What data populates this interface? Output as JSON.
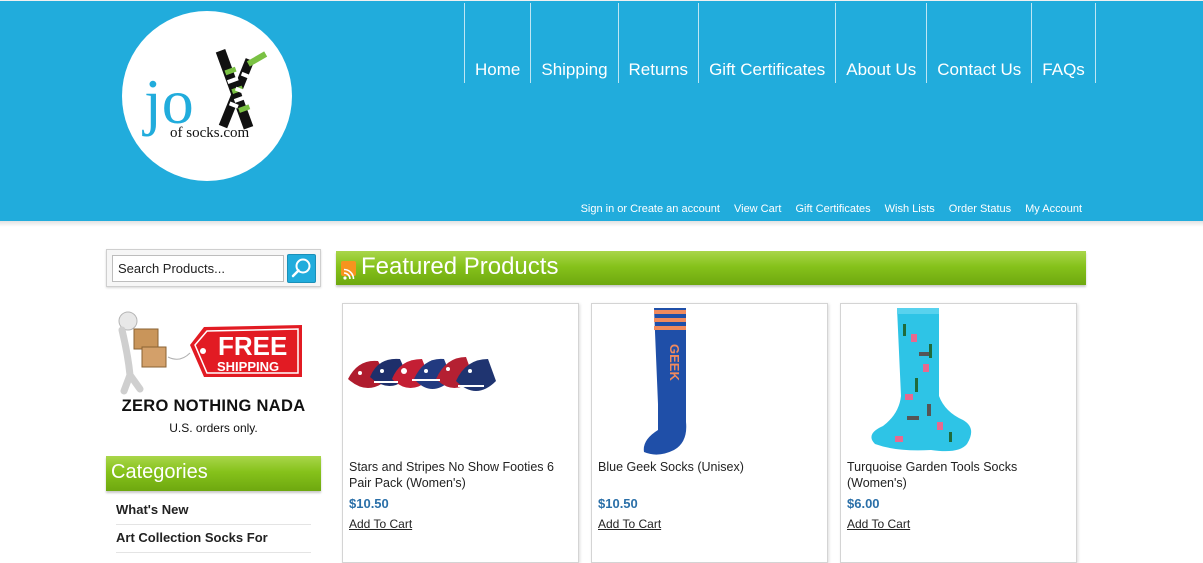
{
  "logo": {
    "text_jo": "jo",
    "text_tagline": "of socks.com"
  },
  "nav": {
    "main": [
      "Home",
      "Shipping",
      "Returns",
      "Gift Certificates",
      "About Us",
      "Contact Us",
      "FAQs"
    ],
    "account": [
      "Sign in or Create an account",
      "View Cart",
      "Gift Certificates",
      "Wish Lists",
      "Order Status",
      "My Account"
    ]
  },
  "search": {
    "value": "Search Products..."
  },
  "promo": {
    "badge_free": "FREE",
    "badge_shipping": "SHIPPING",
    "headline": "ZERO NOTHING NADA",
    "note": "U.S. orders only."
  },
  "categories": {
    "title": "Categories",
    "items": [
      "What's New",
      "Art Collection Socks For"
    ]
  },
  "featured": {
    "title": "Featured Products",
    "products": [
      {
        "name": "Stars and Stripes No Show Footies 6 Pair Pack (Women's)",
        "price": "$10.50",
        "cart": "Add To Cart"
      },
      {
        "name": "Blue Geek Socks (Unisex)",
        "price": "$10.50",
        "cart": "Add To Cart",
        "sock_text": "GEEK"
      },
      {
        "name": "Turquoise Garden Tools Socks (Women's)",
        "price": "$6.00",
        "cart": "Add To Cart"
      }
    ]
  },
  "colors": {
    "header": "#21acdc",
    "accent_green": "#86c21b",
    "price": "#2a6fa8",
    "promo_red": "#e21b23"
  },
  "icons": {
    "search": "magnifier-icon",
    "rss": "rss-icon"
  }
}
